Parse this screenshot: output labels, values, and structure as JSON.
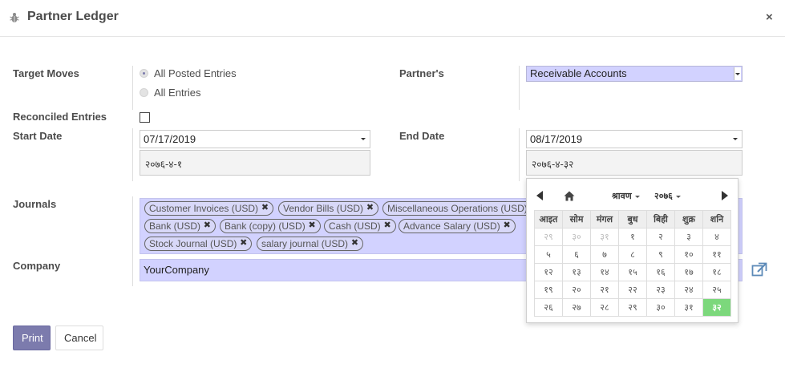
{
  "dialog": {
    "title": "Partner Ledger",
    "close": "×"
  },
  "form": {
    "target_moves": {
      "label": "Target Moves",
      "options": [
        "All Posted Entries",
        "All Entries"
      ],
      "selected": "All Posted Entries"
    },
    "partners": {
      "label": "Partner's",
      "value": "Receivable Accounts"
    },
    "reconciled": {
      "label": "Reconciled Entries",
      "checked": false
    },
    "start_date": {
      "label": "Start Date",
      "value": "07/17/2019",
      "nepali": "२०७६-४-१"
    },
    "end_date": {
      "label": "End Date",
      "value": "08/17/2019",
      "nepali": "२०७६-४-३२"
    },
    "journals": {
      "label": "Journals",
      "tags": [
        "Customer Invoices (USD)",
        "Vendor Bills (USD)",
        "Miscellaneous Operations (USD)",
        "Bank (USD)",
        "Bank (copy) (USD)",
        "Cash (USD)",
        "Advance Salary (USD)",
        "Stock Journal (USD)",
        "salary journal (USD)"
      ],
      "remove_glyph": "✖"
    },
    "company": {
      "label": "Company",
      "value": "YourCompany"
    }
  },
  "buttons": {
    "print": "Print",
    "cancel": "Cancel"
  },
  "datepicker": {
    "month": "श्रावण",
    "year": "२०७६",
    "weekdays": [
      "आइत",
      "सोम",
      "मंगल",
      "बुध",
      "बिही",
      "शुक्र",
      "शनि"
    ],
    "weeks": [
      [
        "२९",
        "३०",
        "३१",
        "१",
        "२",
        "३",
        "४"
      ],
      [
        "५",
        "६",
        "७",
        "८",
        "९",
        "१०",
        "११"
      ],
      [
        "१२",
        "१३",
        "१४",
        "१५",
        "१६",
        "१७",
        "१८"
      ],
      [
        "१९",
        "२०",
        "२१",
        "२२",
        "२३",
        "२४",
        "२५"
      ],
      [
        "२६",
        "२७",
        "२८",
        "२९",
        "३०",
        "३१",
        "३२"
      ]
    ],
    "selected_day": "३२",
    "colors": {
      "selected": "#7cd87c",
      "accent": "#7c7bad",
      "field": "#d2d2ff"
    }
  }
}
